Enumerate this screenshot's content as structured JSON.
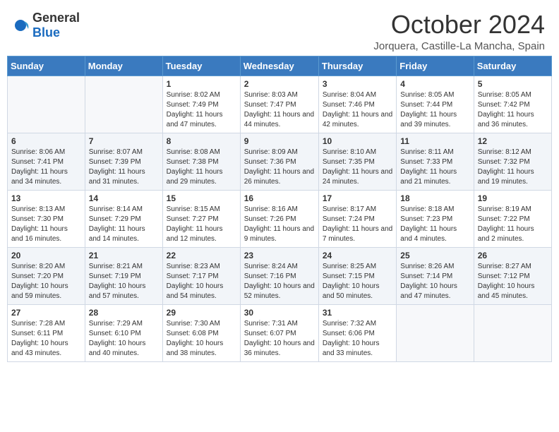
{
  "header": {
    "logo_general": "General",
    "logo_blue": "Blue",
    "month": "October 2024",
    "location": "Jorquera, Castille-La Mancha, Spain"
  },
  "weekdays": [
    "Sunday",
    "Monday",
    "Tuesday",
    "Wednesday",
    "Thursday",
    "Friday",
    "Saturday"
  ],
  "weeks": [
    [
      {
        "day": "",
        "sunrise": "",
        "sunset": "",
        "daylight": ""
      },
      {
        "day": "",
        "sunrise": "",
        "sunset": "",
        "daylight": ""
      },
      {
        "day": "1",
        "sunrise": "Sunrise: 8:02 AM",
        "sunset": "Sunset: 7:49 PM",
        "daylight": "Daylight: 11 hours and 47 minutes."
      },
      {
        "day": "2",
        "sunrise": "Sunrise: 8:03 AM",
        "sunset": "Sunset: 7:47 PM",
        "daylight": "Daylight: 11 hours and 44 minutes."
      },
      {
        "day": "3",
        "sunrise": "Sunrise: 8:04 AM",
        "sunset": "Sunset: 7:46 PM",
        "daylight": "Daylight: 11 hours and 42 minutes."
      },
      {
        "day": "4",
        "sunrise": "Sunrise: 8:05 AM",
        "sunset": "Sunset: 7:44 PM",
        "daylight": "Daylight: 11 hours and 39 minutes."
      },
      {
        "day": "5",
        "sunrise": "Sunrise: 8:05 AM",
        "sunset": "Sunset: 7:42 PM",
        "daylight": "Daylight: 11 hours and 36 minutes."
      }
    ],
    [
      {
        "day": "6",
        "sunrise": "Sunrise: 8:06 AM",
        "sunset": "Sunset: 7:41 PM",
        "daylight": "Daylight: 11 hours and 34 minutes."
      },
      {
        "day": "7",
        "sunrise": "Sunrise: 8:07 AM",
        "sunset": "Sunset: 7:39 PM",
        "daylight": "Daylight: 11 hours and 31 minutes."
      },
      {
        "day": "8",
        "sunrise": "Sunrise: 8:08 AM",
        "sunset": "Sunset: 7:38 PM",
        "daylight": "Daylight: 11 hours and 29 minutes."
      },
      {
        "day": "9",
        "sunrise": "Sunrise: 8:09 AM",
        "sunset": "Sunset: 7:36 PM",
        "daylight": "Daylight: 11 hours and 26 minutes."
      },
      {
        "day": "10",
        "sunrise": "Sunrise: 8:10 AM",
        "sunset": "Sunset: 7:35 PM",
        "daylight": "Daylight: 11 hours and 24 minutes."
      },
      {
        "day": "11",
        "sunrise": "Sunrise: 8:11 AM",
        "sunset": "Sunset: 7:33 PM",
        "daylight": "Daylight: 11 hours and 21 minutes."
      },
      {
        "day": "12",
        "sunrise": "Sunrise: 8:12 AM",
        "sunset": "Sunset: 7:32 PM",
        "daylight": "Daylight: 11 hours and 19 minutes."
      }
    ],
    [
      {
        "day": "13",
        "sunrise": "Sunrise: 8:13 AM",
        "sunset": "Sunset: 7:30 PM",
        "daylight": "Daylight: 11 hours and 16 minutes."
      },
      {
        "day": "14",
        "sunrise": "Sunrise: 8:14 AM",
        "sunset": "Sunset: 7:29 PM",
        "daylight": "Daylight: 11 hours and 14 minutes."
      },
      {
        "day": "15",
        "sunrise": "Sunrise: 8:15 AM",
        "sunset": "Sunset: 7:27 PM",
        "daylight": "Daylight: 11 hours and 12 minutes."
      },
      {
        "day": "16",
        "sunrise": "Sunrise: 8:16 AM",
        "sunset": "Sunset: 7:26 PM",
        "daylight": "Daylight: 11 hours and 9 minutes."
      },
      {
        "day": "17",
        "sunrise": "Sunrise: 8:17 AM",
        "sunset": "Sunset: 7:24 PM",
        "daylight": "Daylight: 11 hours and 7 minutes."
      },
      {
        "day": "18",
        "sunrise": "Sunrise: 8:18 AM",
        "sunset": "Sunset: 7:23 PM",
        "daylight": "Daylight: 11 hours and 4 minutes."
      },
      {
        "day": "19",
        "sunrise": "Sunrise: 8:19 AM",
        "sunset": "Sunset: 7:22 PM",
        "daylight": "Daylight: 11 hours and 2 minutes."
      }
    ],
    [
      {
        "day": "20",
        "sunrise": "Sunrise: 8:20 AM",
        "sunset": "Sunset: 7:20 PM",
        "daylight": "Daylight: 10 hours and 59 minutes."
      },
      {
        "day": "21",
        "sunrise": "Sunrise: 8:21 AM",
        "sunset": "Sunset: 7:19 PM",
        "daylight": "Daylight: 10 hours and 57 minutes."
      },
      {
        "day": "22",
        "sunrise": "Sunrise: 8:23 AM",
        "sunset": "Sunset: 7:17 PM",
        "daylight": "Daylight: 10 hours and 54 minutes."
      },
      {
        "day": "23",
        "sunrise": "Sunrise: 8:24 AM",
        "sunset": "Sunset: 7:16 PM",
        "daylight": "Daylight: 10 hours and 52 minutes."
      },
      {
        "day": "24",
        "sunrise": "Sunrise: 8:25 AM",
        "sunset": "Sunset: 7:15 PM",
        "daylight": "Daylight: 10 hours and 50 minutes."
      },
      {
        "day": "25",
        "sunrise": "Sunrise: 8:26 AM",
        "sunset": "Sunset: 7:14 PM",
        "daylight": "Daylight: 10 hours and 47 minutes."
      },
      {
        "day": "26",
        "sunrise": "Sunrise: 8:27 AM",
        "sunset": "Sunset: 7:12 PM",
        "daylight": "Daylight: 10 hours and 45 minutes."
      }
    ],
    [
      {
        "day": "27",
        "sunrise": "Sunrise: 7:28 AM",
        "sunset": "Sunset: 6:11 PM",
        "daylight": "Daylight: 10 hours and 43 minutes."
      },
      {
        "day": "28",
        "sunrise": "Sunrise: 7:29 AM",
        "sunset": "Sunset: 6:10 PM",
        "daylight": "Daylight: 10 hours and 40 minutes."
      },
      {
        "day": "29",
        "sunrise": "Sunrise: 7:30 AM",
        "sunset": "Sunset: 6:08 PM",
        "daylight": "Daylight: 10 hours and 38 minutes."
      },
      {
        "day": "30",
        "sunrise": "Sunrise: 7:31 AM",
        "sunset": "Sunset: 6:07 PM",
        "daylight": "Daylight: 10 hours and 36 minutes."
      },
      {
        "day": "31",
        "sunrise": "Sunrise: 7:32 AM",
        "sunset": "Sunset: 6:06 PM",
        "daylight": "Daylight: 10 hours and 33 minutes."
      },
      {
        "day": "",
        "sunrise": "",
        "sunset": "",
        "daylight": ""
      },
      {
        "day": "",
        "sunrise": "",
        "sunset": "",
        "daylight": ""
      }
    ]
  ]
}
